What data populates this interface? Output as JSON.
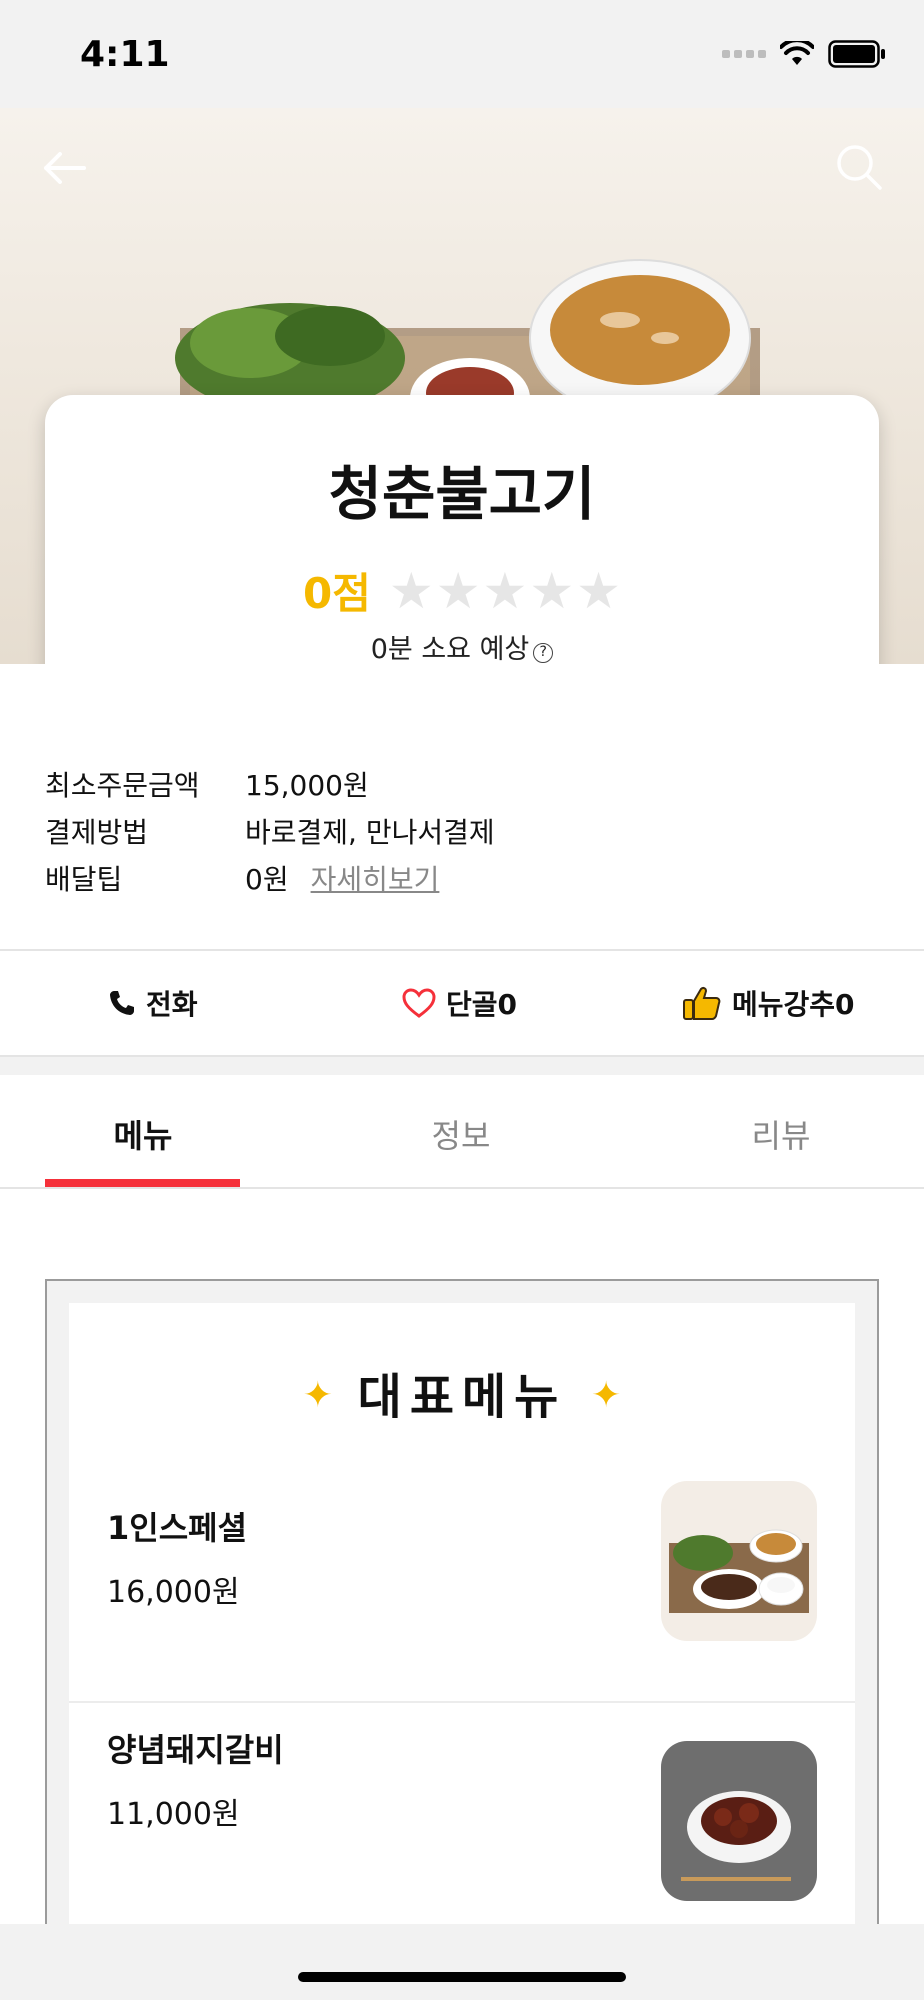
{
  "status_bar": {
    "time": "4:11"
  },
  "store": {
    "name": "청춘불고기",
    "rating": "0점",
    "stars": [
      "★",
      "★",
      "★",
      "★",
      "★"
    ],
    "estimated_time": "0분 소요 예상"
  },
  "info": {
    "min_order_label": "최소주문금액",
    "min_order_value": "15,000원",
    "payment_label": "결제방법",
    "payment_value": "바로결제, 만나서결제",
    "delivery_tip_label": "배달팁",
    "delivery_tip_value": "0원",
    "details_link": "자세히보기"
  },
  "actions": {
    "call": "전화",
    "favorite": "단골0",
    "recommend": "메뉴강추0"
  },
  "tabs": [
    "메뉴",
    "정보",
    "리뷰"
  ],
  "featured": {
    "title": "대표메뉴",
    "items": [
      {
        "name": "1인스페셜",
        "price": "16,000원"
      },
      {
        "name": "양념돼지갈비",
        "price": "11,000원"
      }
    ]
  },
  "colors": {
    "accent_red": "#f5303a",
    "rating_yellow": "#f5b800"
  }
}
